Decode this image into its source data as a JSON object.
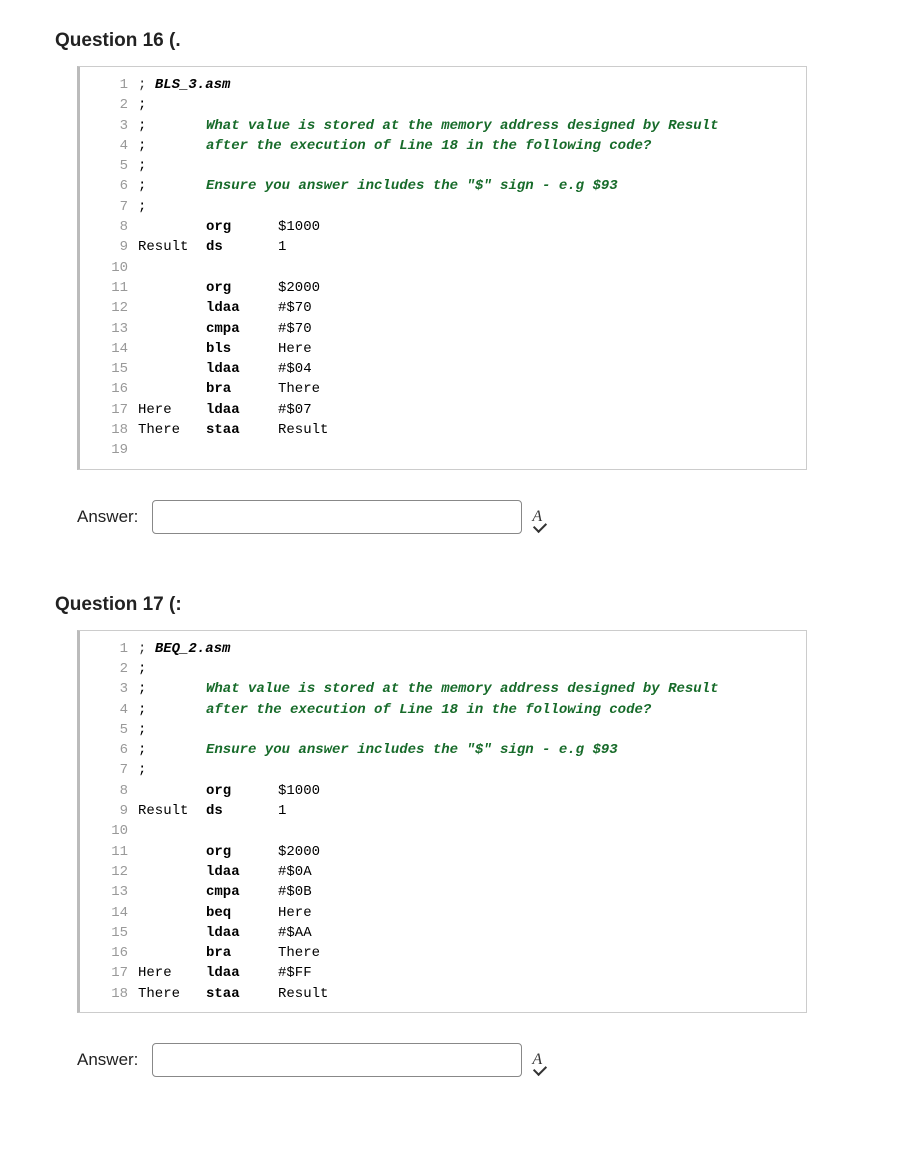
{
  "questions": [
    {
      "title": "Question 16 (.",
      "answer_label": "Answer:",
      "lines": [
        {
          "n": "1",
          "label": ";",
          "op": "",
          "arg": "",
          "header": "BLS_3.asm"
        },
        {
          "n": "2",
          "label": ";",
          "op": "",
          "arg": ""
        },
        {
          "n": "3",
          "label": ";",
          "comment": "What value is stored at the memory address designed by Result"
        },
        {
          "n": "4",
          "label": ";",
          "comment": "after the execution of Line 18 in the following code?"
        },
        {
          "n": "5",
          "label": ";"
        },
        {
          "n": "6",
          "label": ";",
          "comment": "Ensure you answer includes the \"$\" sign - e.g $93"
        },
        {
          "n": "7",
          "label": ";"
        },
        {
          "n": "8",
          "label": "",
          "op": "org",
          "arg": "$1000"
        },
        {
          "n": "9",
          "label": "Result",
          "op": "ds",
          "arg": "1"
        },
        {
          "n": "10",
          "label": ""
        },
        {
          "n": "11",
          "label": "",
          "op": "org",
          "arg": "$2000"
        },
        {
          "n": "12",
          "label": "",
          "op": "ldaa",
          "arg": "#$70"
        },
        {
          "n": "13",
          "label": "",
          "op": "cmpa",
          "arg": "#$70"
        },
        {
          "n": "14",
          "label": "",
          "op": "bls",
          "arg": "Here"
        },
        {
          "n": "15",
          "label": "",
          "op": "ldaa",
          "arg": "#$04"
        },
        {
          "n": "16",
          "label": "",
          "op": "bra",
          "arg": "There"
        },
        {
          "n": "17",
          "label": "Here",
          "op": "ldaa",
          "arg": "#$07"
        },
        {
          "n": "18",
          "label": "There",
          "op": "staa",
          "arg": "Result"
        },
        {
          "n": "19",
          "label": ""
        }
      ]
    },
    {
      "title": "Question 17 (:",
      "answer_label": "Answer:",
      "lines": [
        {
          "n": "1",
          "label": ";",
          "header": "BEQ_2.asm"
        },
        {
          "n": "2",
          "label": ";"
        },
        {
          "n": "3",
          "label": ";",
          "comment": "What value is stored at the memory address designed by Result"
        },
        {
          "n": "4",
          "label": ";",
          "comment": "after the execution of Line 18 in the following code?"
        },
        {
          "n": "5",
          "label": ";"
        },
        {
          "n": "6",
          "label": ";",
          "comment": "Ensure you answer includes the \"$\" sign - e.g $93"
        },
        {
          "n": "7",
          "label": ";"
        },
        {
          "n": "8",
          "label": "",
          "op": "org",
          "arg": "$1000"
        },
        {
          "n": "9",
          "label": "Result",
          "op": "ds",
          "arg": "1"
        },
        {
          "n": "10",
          "label": ""
        },
        {
          "n": "11",
          "label": "",
          "op": "org",
          "arg": "$2000"
        },
        {
          "n": "12",
          "label": "",
          "op": "ldaa",
          "arg": "#$0A"
        },
        {
          "n": "13",
          "label": "",
          "op": "cmpa",
          "arg": "#$0B"
        },
        {
          "n": "14",
          "label": "",
          "op": "beq",
          "arg": "Here"
        },
        {
          "n": "15",
          "label": "",
          "op": "ldaa",
          "arg": "#$AA"
        },
        {
          "n": "16",
          "label": "",
          "op": "bra",
          "arg": "There"
        },
        {
          "n": "17",
          "label": "Here",
          "op": "ldaa",
          "arg": "#$FF"
        },
        {
          "n": "18",
          "label": "There",
          "op": "staa",
          "arg": "Result"
        }
      ]
    }
  ]
}
